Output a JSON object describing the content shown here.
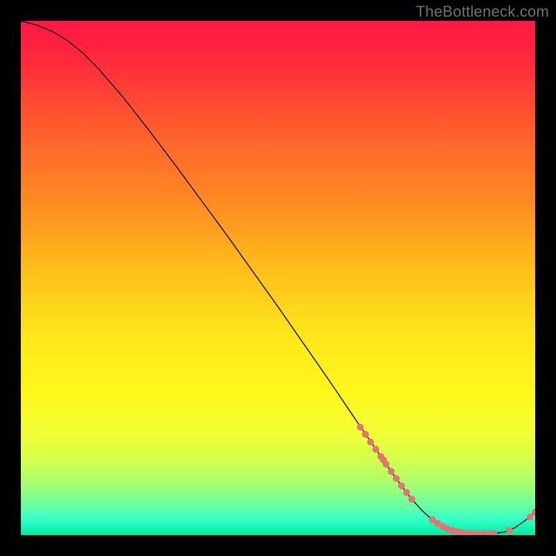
{
  "watermark": "TheBottleneck.com",
  "chart_data": {
    "type": "line",
    "title": "",
    "xlabel": "",
    "ylabel": "",
    "xlim": [
      0,
      100
    ],
    "ylim": [
      0,
      100
    ],
    "gradient": {
      "stops": [
        {
          "offset": 0.0,
          "color": "#ff1744"
        },
        {
          "offset": 0.08,
          "color": "#ff2a3c"
        },
        {
          "offset": 0.2,
          "color": "#ff5a2e"
        },
        {
          "offset": 0.35,
          "color": "#ff8a22"
        },
        {
          "offset": 0.5,
          "color": "#ffc41a"
        },
        {
          "offset": 0.62,
          "color": "#ffe81a"
        },
        {
          "offset": 0.72,
          "color": "#fff61a"
        },
        {
          "offset": 0.8,
          "color": "#f2ff35"
        },
        {
          "offset": 0.85,
          "color": "#d6ff4a"
        },
        {
          "offset": 0.9,
          "color": "#a8ff70"
        },
        {
          "offset": 0.94,
          "color": "#6cffa0"
        },
        {
          "offset": 0.97,
          "color": "#33ffc8"
        },
        {
          "offset": 1.0,
          "color": "#00e8a0"
        }
      ]
    },
    "series": [
      {
        "name": "curve",
        "stroke": "#000000",
        "stroke_width": 1.4,
        "x": [
          0,
          3,
          6,
          9,
          12,
          15,
          20,
          25,
          30,
          35,
          40,
          45,
          50,
          55,
          60,
          65,
          70,
          72,
          74,
          76,
          78,
          80,
          82,
          84,
          86,
          88,
          90,
          92,
          94,
          96,
          98,
          100
        ],
        "y": [
          100,
          99.2,
          98,
          96.2,
          93.8,
          90.8,
          85.0,
          78.6,
          72.0,
          65.2,
          58.4,
          51.4,
          44.4,
          37.2,
          30.0,
          22.6,
          15.3,
          12.4,
          9.6,
          7.0,
          4.8,
          3.0,
          1.7,
          0.9,
          0.4,
          0.2,
          0.2,
          0.3,
          0.6,
          1.4,
          2.8,
          4.5
        ]
      }
    ],
    "points": {
      "color": "#e57373",
      "radius": 5,
      "x": [
        66,
        67,
        68,
        69,
        70,
        70.5,
        71,
        72,
        73,
        74,
        75,
        76,
        80,
        81,
        82,
        83,
        84,
        85,
        86,
        87,
        88,
        89,
        90,
        91,
        92,
        95,
        99,
        100
      ],
      "y": [
        21.0,
        19.6,
        18.1,
        16.7,
        15.3,
        14.6,
        13.8,
        12.4,
        11.0,
        9.6,
        8.3,
        7.0,
        3.0,
        2.3,
        1.7,
        1.2,
        0.9,
        0.6,
        0.4,
        0.3,
        0.2,
        0.2,
        0.2,
        0.2,
        0.3,
        0.9,
        3.5,
        4.5
      ]
    }
  }
}
